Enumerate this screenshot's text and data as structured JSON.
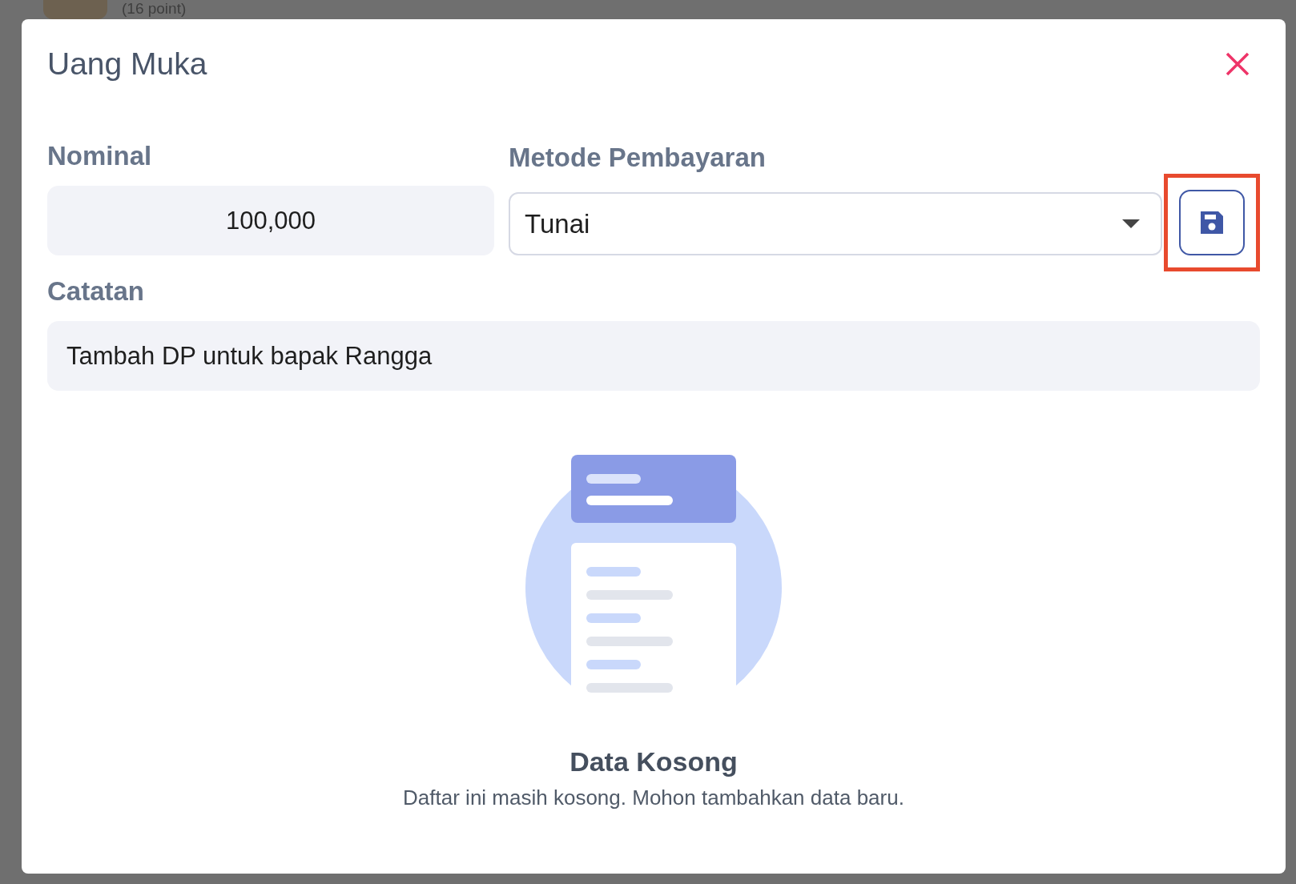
{
  "background": {
    "caption": "(16 point)"
  },
  "dialog": {
    "title": "Uang Muka",
    "nominal": {
      "label": "Nominal",
      "value": "100,000"
    },
    "payment_method": {
      "label": "Metode Pembayaran",
      "value": "Tunai"
    },
    "save_button": {
      "highlighted": true
    },
    "note": {
      "label": "Catatan",
      "value": "Tambah DP untuk bapak Rangga"
    },
    "empty_state": {
      "title": "Data Kosong",
      "message": "Daftar ini masih kosong. Mohon tambahkan data baru."
    }
  }
}
